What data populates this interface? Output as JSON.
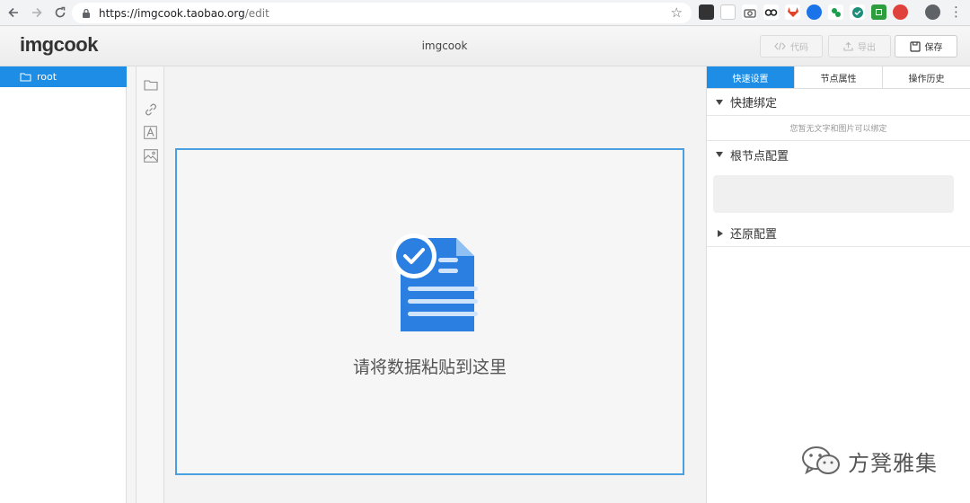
{
  "browser": {
    "url_host": "https://imgcook.taobao.org",
    "url_path": "/edit"
  },
  "app": {
    "logo": "imgcook",
    "title": "imgcook",
    "buttons": {
      "code": "代码",
      "export": "导出",
      "save": "保存"
    }
  },
  "tree": {
    "root_label": "root"
  },
  "canvas": {
    "drop_text": "请将数据粘贴到这里"
  },
  "right_panel": {
    "tabs": [
      "快速设置",
      "节点属性",
      "操作历史"
    ],
    "sections": {
      "quick_bind": "快捷绑定",
      "quick_bind_hint": "您暂无文字和图片可以绑定",
      "root_config": "根节点配置",
      "restore_config": "还原配置"
    }
  },
  "watermark": {
    "text": "方凳雅集"
  },
  "colors": {
    "accent": "#1e8de6",
    "doc_blue": "#2a7fe0"
  }
}
